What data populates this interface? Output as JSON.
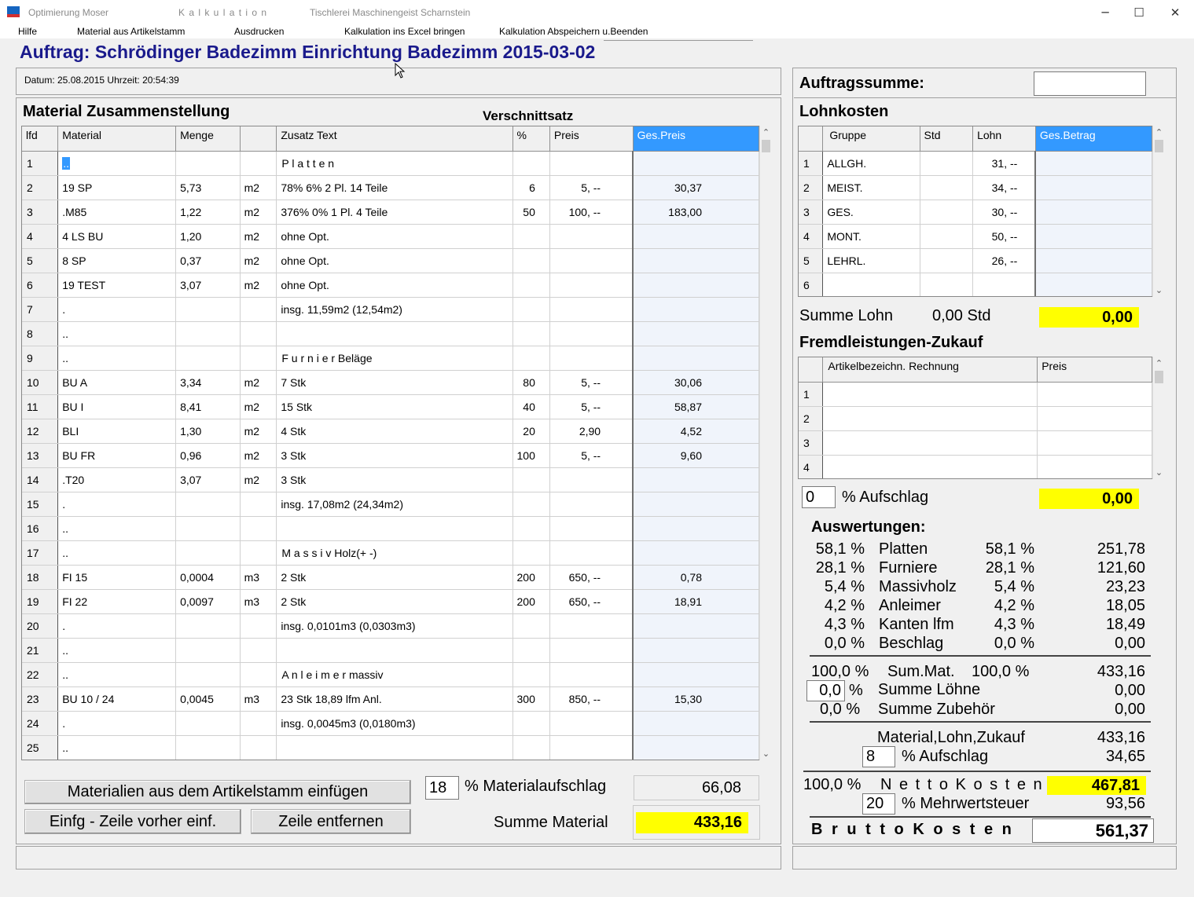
{
  "window": {
    "title1": "Optimierung Moser",
    "title2": "K a l k u l a t i o n",
    "title3": "Tischlerei Maschinengeist  Scharnstein",
    "min_icon": "minimize-icon",
    "max_icon": "maximize-icon",
    "close_icon": "close-icon",
    "min_glyph": "─",
    "max_glyph": "☐",
    "close_glyph": "✕"
  },
  "menu": {
    "hilfe": "Hilfe",
    "material": "Material aus Artikelstamm",
    "ausdrucken": "Ausdrucken",
    "excel": "Kalkulation ins Excel bringen",
    "abspeichern": "Kalkulation Abspeichern u.Beenden"
  },
  "header": {
    "auftrag": "Auftrag: Schrödinger Badezimm  Einrichtung Badezimm  2015-03-02",
    "datum": "Datum: 25.08.2015   Uhrzeit:  20:54:39"
  },
  "material": {
    "title": "Material Zusammenstellung",
    "verschnitt": "Verschnittsatz",
    "columns": [
      "lfd",
      "Material",
      "Menge",
      "",
      "Zusatz Text",
      "%",
      "Preis",
      "Ges.Preis"
    ],
    "rows": [
      [
        "1",
        "..",
        "",
        "",
        "P l a t t e n",
        "",
        "",
        ""
      ],
      [
        "2",
        "19 SP",
        "5,73",
        "m2",
        "78%   6%   2 Pl.    14 Teile",
        "6",
        "5, --",
        "30,37"
      ],
      [
        "3",
        ".M85",
        "1,22",
        "m2",
        "376%   0%   1 Pl.    4 Teile",
        "50",
        "100, --",
        "183,00"
      ],
      [
        "4",
        "4 LS BU",
        "1,20",
        "m2",
        "ohne Opt.",
        "",
        "",
        ""
      ],
      [
        "5",
        "8 SP",
        "0,37",
        "m2",
        "ohne Opt.",
        "",
        "",
        ""
      ],
      [
        "6",
        "19 TEST",
        "3,07",
        "m2",
        "ohne Opt.",
        "",
        "",
        ""
      ],
      [
        "7",
        ".",
        "",
        "",
        "insg. 11,59m2 (12,54m2)",
        "",
        "",
        ""
      ],
      [
        "8",
        "..",
        "",
        "",
        "",
        "",
        "",
        ""
      ],
      [
        "9",
        "..",
        "",
        "",
        "F u r n i e r   Beläge",
        "",
        "",
        ""
      ],
      [
        "10",
        "BU A",
        "3,34",
        "m2",
        "7 Stk",
        "80",
        "5, --",
        "30,06"
      ],
      [
        "11",
        "BU I",
        "8,41",
        "m2",
        "15 Stk",
        "40",
        "5, --",
        "58,87"
      ],
      [
        "12",
        "BLI",
        "1,30",
        "m2",
        "4 Stk",
        "20",
        "2,90",
        "4,52"
      ],
      [
        "13",
        "BU FR",
        "0,96",
        "m2",
        "3 Stk",
        "100",
        "5, --",
        "9,60"
      ],
      [
        "14",
        ".T20",
        "3,07",
        "m2",
        "3 Stk",
        "",
        "",
        ""
      ],
      [
        "15",
        ".",
        "",
        "",
        "insg. 17,08m2 (24,34m2)",
        "",
        "",
        ""
      ],
      [
        "16",
        "..",
        "",
        "",
        "",
        "",
        "",
        ""
      ],
      [
        "17",
        "..",
        "",
        "",
        "M a s s i v Holz(+ -)",
        "",
        "",
        ""
      ],
      [
        "18",
        "FI 15",
        "0,0004",
        "m3",
        "2 Stk",
        "200",
        "650, --",
        "0,78"
      ],
      [
        "19",
        "FI 22",
        "0,0097",
        "m3",
        "2 Stk",
        "200",
        "650, --",
        "18,91"
      ],
      [
        "20",
        ".",
        "",
        "",
        "insg. 0,0101m3 (0,0303m3)",
        "",
        "",
        ""
      ],
      [
        "21",
        "..",
        "",
        "",
        "",
        "",
        "",
        ""
      ],
      [
        "22",
        "..",
        "",
        "",
        "A n l e i m e r   massiv",
        "",
        "",
        ""
      ],
      [
        "23",
        "BU 10 / 24",
        "0,0045",
        "m3",
        "23 Stk  18,89 lfm Anl.",
        "300",
        "850, --",
        "15,30"
      ],
      [
        "24",
        ".",
        "",
        "",
        "insg. 0,0045m3 (0,0180m3)",
        "",
        "",
        ""
      ],
      [
        "25",
        "..",
        "",
        "",
        "",
        "",
        "",
        ""
      ]
    ]
  },
  "buttons": {
    "einfuegen": "Materialien aus dem Artikelstamm einfügen",
    "zeile_vorher": "Einfg - Zeile vorher einf.",
    "zeile_entfernen": "Zeile entfernen"
  },
  "bottom": {
    "aufschlag_pct": "18",
    "aufschlag_label": "% Materialaufschlag",
    "aufschlag_value": "66,08",
    "summe_label": "Summe Material",
    "summe_value": "433,16"
  },
  "right": {
    "auftragssumme": "Auftragssumme:",
    "lohnkosten": "Lohnkosten",
    "lohn_columns": [
      "",
      "Gruppe",
      "Std",
      "Lohn",
      "Ges.Betrag"
    ],
    "lohn_rows": [
      [
        "1",
        "ALLGH.",
        "",
        "31, --",
        ""
      ],
      [
        "2",
        "MEIST.",
        "",
        "34, --",
        ""
      ],
      [
        "3",
        "GES.",
        "",
        "30, --",
        ""
      ],
      [
        "4",
        "MONT.",
        "",
        "50, --",
        ""
      ],
      [
        "5",
        "LEHRL.",
        "",
        "26, --",
        ""
      ],
      [
        "6",
        "",
        "",
        "",
        ""
      ]
    ],
    "summe_lohn": "Summe Lohn",
    "summe_lohn_std": "0,00 Std",
    "summe_lohn_value": "0,00",
    "fremd_title": "Fremdleistungen-Zukauf",
    "fremd_columns": [
      "",
      "Artikelbezeichn. Rechnung",
      "Preis"
    ],
    "fremd_rows": [
      [
        "1",
        "",
        ""
      ],
      [
        "2",
        "",
        ""
      ],
      [
        "3",
        "",
        ""
      ],
      [
        "4",
        "",
        ""
      ]
    ],
    "fremd_pct": "0",
    "fremd_label": "%  Aufschlag",
    "fremd_value": "0,00",
    "auswertungen": "Auswertungen:",
    "ausw_rows": [
      [
        "58,1 %",
        "Platten",
        "58,1 %",
        "251,78"
      ],
      [
        "28,1 %",
        "Furniere",
        "28,1 %",
        "121,60"
      ],
      [
        "5,4 %",
        "Massivholz",
        "5,4 %",
        "23,23"
      ],
      [
        "4,2 %",
        "Anleimer",
        "4,2 %",
        "18,05"
      ],
      [
        "4,3 %",
        "Kanten lfm",
        "4,3 %",
        "18,49"
      ],
      [
        "0,0 %",
        "Beschlag",
        "0,0 %",
        "0,00"
      ]
    ],
    "summat_pct": "100,0 %",
    "summat_label": "Sum.Mat.",
    "summat_pct2": "100,0 %",
    "summat_value": "433,16",
    "loehne_pct": "0,0",
    "loehne_pct_sign": "%",
    "loehne_label": "Summe Löhne",
    "loehne_value": "0,00",
    "zubehoer_pct": "0,0 %",
    "zubehoer_label": "Summe Zubehör",
    "zubehoer_value": "0,00",
    "mlz_label": "Material,Lohn,Zukauf",
    "mlz_value": "433,16",
    "aufschlag_pct": "8",
    "aufschlag_label": "%  Aufschlag",
    "aufschlag_value": "34,65",
    "netto_pct": "100,0 %",
    "netto_label": "N e t t o   K o s t e n",
    "netto_value": "467,81",
    "mwst_pct": "20",
    "mwst_label": "%  Mehrwertsteuer",
    "mwst_value": "93,56",
    "brutto_label": "B r u t t o   K o s t e n",
    "brutto_value": "561,37"
  },
  "colors": {
    "title_blue": "#1a1a8c",
    "highlight_yellow": "#ffff00",
    "header_selected": "#3399ff"
  }
}
